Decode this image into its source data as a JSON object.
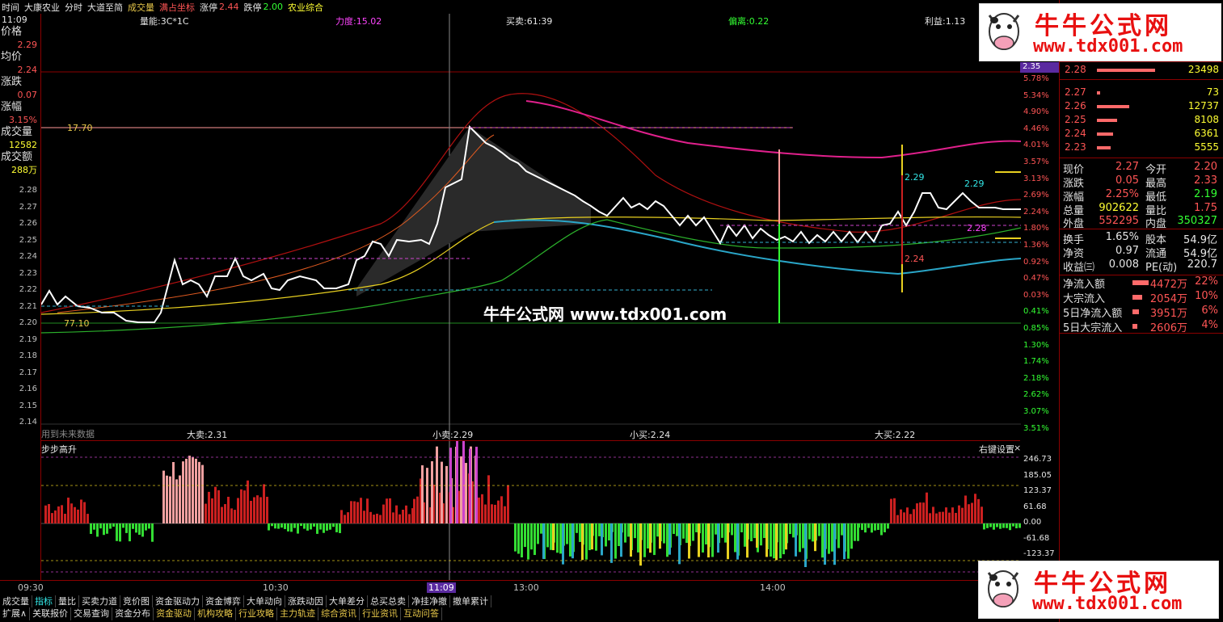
{
  "topbar": {
    "time_label": "时间",
    "stock_name": "大康农业",
    "view_mode": "分时",
    "formula": "大道至简",
    "volume_label": "成交量",
    "coord_mode": "满占坐标",
    "limit_up_label": "涨停",
    "limit_up_value": "2.44",
    "limit_down_label": "跌停",
    "limit_down_value": "2.00",
    "sector": "农业综合"
  },
  "left_panel": {
    "time": "11:09",
    "price_label": "价格",
    "price_value": "2.29",
    "avg_label": "均价",
    "avg_value": "2.24",
    "change_label": "涨跌",
    "change_value": "0.07",
    "pct_label": "涨幅",
    "pct_value": "3.15%",
    "vol_label": "成交量",
    "vol_value": "12582",
    "amount_label": "成交额",
    "amount_value": "288万"
  },
  "indicators": {
    "liang_neng": "量能:3C*1C",
    "li_du": "力度:15.02",
    "mai_mai": "买卖:61:39",
    "pian_li": "偏离:0.22",
    "li_yi": "利益:1.13",
    "da_mai_sell": "大卖:2.31",
    "xiao_mai_sell": "小卖:2.29",
    "xiao_mai_buy": "小买:2.24",
    "da_mai_buy": "大买:2.22",
    "future_data": "用到未来数据",
    "line_top": "17.70",
    "line_bottom": "77.10",
    "marker_229a": "2.29",
    "marker_229b": "2.29",
    "marker_228": "2.28",
    "marker_224": "2.24"
  },
  "left_axis": [
    "2.28",
    "2.27",
    "2.26",
    "2.25",
    "2.24",
    "2.23",
    "2.22",
    "2.21",
    "2.20",
    "2.19",
    "2.18",
    "2.17",
    "2.16",
    "2.15",
    "2.14"
  ],
  "right_axis": {
    "current": "2.35",
    "ticks": [
      "5.78%",
      "5.34%",
      "4.90%",
      "4.46%",
      "4.01%",
      "3.57%",
      "3.13%",
      "2.69%",
      "2.24%",
      "1.80%",
      "1.36%",
      "0.92%",
      "0.47%",
      "0.03%",
      "0.41%",
      "0.85%",
      "1.30%",
      "1.74%",
      "2.18%",
      "2.62%",
      "3.07%",
      "3.51%"
    ],
    "tick_colors": [
      "red",
      "red",
      "red",
      "red",
      "red",
      "red",
      "red",
      "red",
      "red",
      "red",
      "red",
      "red",
      "red",
      "red",
      "green",
      "green",
      "green",
      "green",
      "green",
      "green",
      "green",
      "green"
    ]
  },
  "sub_chart": {
    "title": "步步高升",
    "settings": "右键设置",
    "close": "×",
    "axis": [
      "246.73",
      "185.05",
      "123.37",
      "61.68",
      "0.00",
      "-61.68",
      "-123.37"
    ]
  },
  "time_axis": {
    "labels": [
      "09:30",
      "10:30",
      "11:09",
      "13:00",
      "14:00"
    ]
  },
  "tabs_row1": [
    "成交量",
    "指标",
    "量比",
    "买卖力道",
    "竞价图",
    "资金驱动力",
    "资金博弈",
    "大单动向",
    "涨跌动因",
    "大单差分",
    "总买总卖",
    "净挂净撤",
    "撤单累计"
  ],
  "tabs_row2": [
    "扩展∧",
    "关联报价",
    "交易查询",
    "资金分布",
    "资金驱动",
    "机构攻略",
    "行业攻略",
    "主力轨迹",
    "综合资讯",
    "行业资讯",
    "互动问答"
  ],
  "order_book": [
    {
      "price": "2.28",
      "vol": "23498",
      "bar": 1.0
    },
    {
      "price": "2.27",
      "vol": "73",
      "bar": 0.05
    },
    {
      "price": "2.26",
      "vol": "12737",
      "bar": 0.55
    },
    {
      "price": "2.25",
      "vol": "8108",
      "bar": 0.35
    },
    {
      "price": "2.24",
      "vol": "6361",
      "bar": 0.28
    },
    {
      "price": "2.23",
      "vol": "5555",
      "bar": 0.24
    }
  ],
  "quote": {
    "now_label": "现价",
    "now": "2.27",
    "open_label": "今开",
    "open": "2.20",
    "chg_label": "涨跌",
    "chg": "0.05",
    "high_label": "最高",
    "high": "2.33",
    "pct_label": "涨幅",
    "pct": "2.25%",
    "low_label": "最低",
    "low": "2.19",
    "total_label": "总量",
    "total": "902622",
    "ratio_label": "量比",
    "ratio": "1.75",
    "outer_label": "外盘",
    "outer": "552295",
    "inner_label": "内盘",
    "inner": "350327",
    "turnover_label": "换手",
    "turnover": "1.65%",
    "capital_label": "股本",
    "capital": "54.9亿",
    "nav_label": "净资",
    "nav": "0.97",
    "float_label": "流通",
    "float": "54.9亿",
    "eps_label": "收益㈢",
    "eps": "0.008",
    "pe_label": "PE(动)",
    "pe": "220.7"
  },
  "flows": [
    {
      "label": "净流入额",
      "value": "4472万",
      "pct": "22%",
      "bar": 1.0
    },
    {
      "label": "大宗流入",
      "value": "2054万",
      "pct": "10%",
      "bar": 0.6
    },
    {
      "label": "5日净流入额",
      "value": "3951万",
      "pct": "6%",
      "bar": 0.4
    },
    {
      "label": "5日大宗流入",
      "value": "2606万",
      "pct": "4%",
      "bar": 0.3
    }
  ],
  "watermark": {
    "title": "牛牛公式网",
    "url": "www.tdx001.com",
    "center": "牛牛公式网 www.tdx001.com"
  },
  "colors": {
    "price_line": "#ffffff",
    "avg_line": "#ffff33",
    "up": "#ff5555",
    "down": "#33ff33",
    "magenta_line": "#e0208c",
    "cyan_line": "#2aa6c8"
  }
}
